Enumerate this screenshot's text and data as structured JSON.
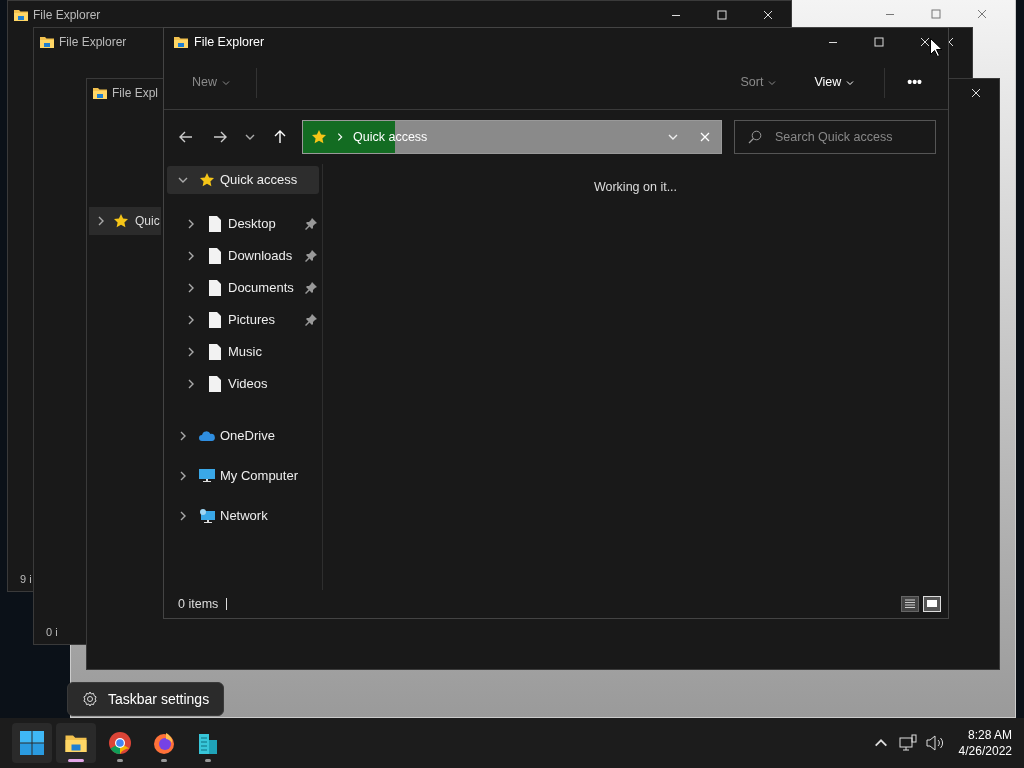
{
  "background_windows": [
    {
      "kind": "light"
    },
    {
      "kind": "dark",
      "title": "File Explorer",
      "status": "9 i"
    },
    {
      "kind": "dark",
      "title": "File Explorer",
      "status": "0 i"
    },
    {
      "kind": "dark",
      "title": "File Expl",
      "sidebar_item": "Quic"
    }
  ],
  "window": {
    "title": "File Explorer",
    "toolbar": [
      {
        "kind": "menu",
        "label": "New",
        "disabled": true
      },
      {
        "kind": "menu",
        "label": "Sort",
        "disabled": true
      },
      {
        "kind": "menu",
        "label": "View",
        "disabled": false
      },
      {
        "kind": "more",
        "label": "•••",
        "disabled": false
      }
    ],
    "address": {
      "location": "Quick access",
      "level": 0.22
    },
    "search": {
      "placeholder": "Search Quick access"
    },
    "tree": [
      {
        "label": "Quick access",
        "kind": "star",
        "expanded": true,
        "selected": true,
        "children": [
          {
            "label": "Desktop",
            "kind": "file",
            "pinned": true
          },
          {
            "label": "Downloads",
            "kind": "file",
            "pinned": true
          },
          {
            "label": "Documents",
            "kind": "file",
            "pinned": true
          },
          {
            "label": "Pictures",
            "kind": "file",
            "pinned": true
          },
          {
            "label": "Music",
            "kind": "file",
            "pinned": false
          },
          {
            "label": "Videos",
            "kind": "file",
            "pinned": false
          }
        ]
      },
      {
        "label": "OneDrive",
        "kind": "cloud",
        "expanded": false,
        "selected": false
      },
      {
        "label": "My Computer",
        "kind": "computer",
        "expanded": false,
        "selected": false
      },
      {
        "label": "Network",
        "kind": "network",
        "expanded": false,
        "selected": false
      }
    ],
    "message": "Working on it...",
    "status_bar": {
      "items": "0 items"
    },
    "views": [
      {
        "kind": "details",
        "selected": false
      },
      {
        "kind": "tiles",
        "selected": true
      }
    ]
  },
  "tooltip": "Taskbar settings",
  "taskbar": {
    "apps": [
      {
        "kind": "start"
      },
      {
        "kind": "explorer",
        "running": true,
        "active": true
      },
      {
        "kind": "chrome",
        "running": true,
        "active": false
      },
      {
        "kind": "firefox",
        "running": true,
        "active": false
      },
      {
        "kind": "building",
        "running": true,
        "active": false
      }
    ],
    "clock": {
      "time": "8:28 AM",
      "date": "4/26/2022"
    }
  }
}
